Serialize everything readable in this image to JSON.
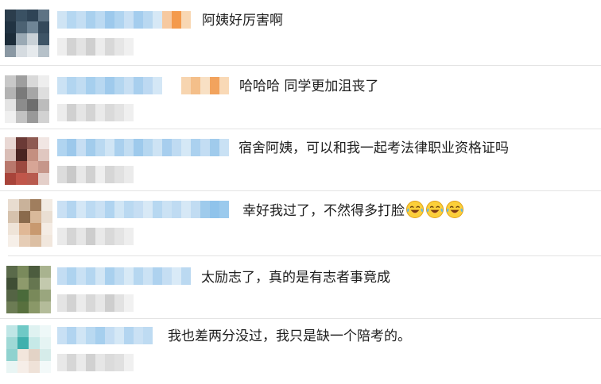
{
  "comments": [
    {
      "text": "阿姨好厉害啊",
      "emojis": 0
    },
    {
      "text": "哈哈哈 同学更加沮丧了",
      "emojis": 0
    },
    {
      "text": "宿舍阿姨，可以和我一起考法律职业资格证吗",
      "emojis": 0
    },
    {
      "text": "幸好我过了，不然得多打脸",
      "emojis": 3,
      "emoji_name": "laugh-cry-icon"
    },
    {
      "text": "太励志了，真的是有志者事竟成",
      "emojis": 0
    },
    {
      "text": "我也差两分没过，我只是缺一个陪考的。",
      "emojis": 0
    }
  ],
  "colors": {
    "text": "#1e1e1e",
    "divider": "#e4e4e4",
    "blurred_name": "#a9d2ee",
    "blurred_meta": "#d9d9d9",
    "background": "#ffffff"
  }
}
